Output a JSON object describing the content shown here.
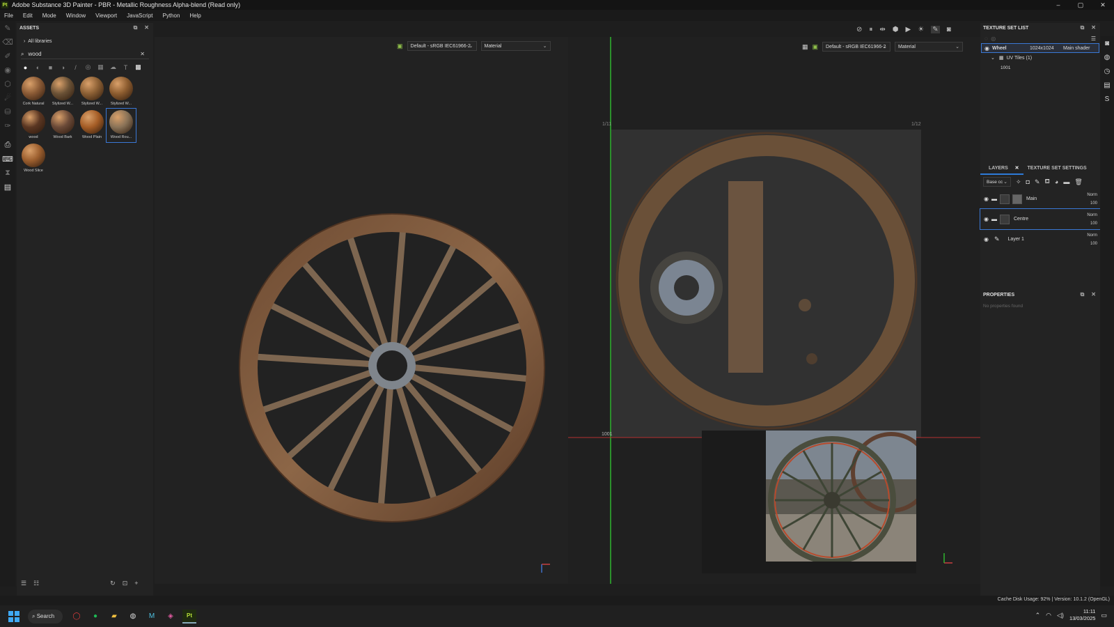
{
  "app": {
    "title": "Adobe Substance 3D Painter - PBR - Metallic Roughness Alpha-blend (Read only)",
    "icon_text": "Pt",
    "window_buttons": [
      "–",
      "▢",
      "✕"
    ]
  },
  "menu": [
    "File",
    "Edit",
    "Mode",
    "Window",
    "Viewport",
    "JavaScript",
    "Python",
    "Help"
  ],
  "assets": {
    "panel_title": "ASSETS",
    "breadcrumb": "All libraries",
    "search_value": "wood",
    "items": [
      {
        "label": "Cork Natural",
        "color": "#8a5a35"
      },
      {
        "label": "Stylized W...",
        "color": "#6b5236"
      },
      {
        "label": "Stylized W...",
        "color": "#8b5f34"
      },
      {
        "label": "Stylized W...",
        "color": "#8c5c2f"
      },
      {
        "label": "wood",
        "color": "#5a3622"
      },
      {
        "label": "Wood Bark",
        "color": "#6b4a38"
      },
      {
        "label": "Wood Plain",
        "color": "#a55d26"
      },
      {
        "label": "Wood Rou...",
        "color": "#8a7358"
      },
      {
        "label": "Wood Slice",
        "color": "#9b5e2e"
      }
    ],
    "selected_index": 7
  },
  "viewport_left": {
    "colorspace": "Default - sRGB IEC61966-2",
    "channel": "Material"
  },
  "viewport_right": {
    "colorspace": "Default - sRGB IEC61966-2",
    "channel": "Material",
    "uv_tile_label": "1001",
    "corner_tl": "1/11",
    "corner_tr": "1/12"
  },
  "texture_set_list": {
    "title": "TEXTURE SET LIST",
    "set_name": "Wheel",
    "resolution": "1024x1024",
    "shader": "Main shader",
    "uv_tiles_label": "UV Tiles (1)",
    "tile": "1001"
  },
  "layers": {
    "tab_layers": "LAYERS",
    "tab_settings": "TEXTURE SET SETTINGS",
    "channel_select": "Base cc",
    "rows": [
      {
        "name": "Main",
        "blend": "Norm",
        "opacity": "100"
      },
      {
        "name": "Centre",
        "blend": "Norm",
        "opacity": "100"
      },
      {
        "name": "Layer 1",
        "blend": "Norm",
        "opacity": "100"
      }
    ]
  },
  "properties": {
    "title": "PROPERTIES",
    "empty_text": "No properties found"
  },
  "status": {
    "text": "Cache Disk Usage:   92% | Version: 10.1.2 (OpenGL)"
  },
  "taskbar": {
    "search_label": "Search",
    "time": "11:11",
    "date": "13/03/2025"
  }
}
